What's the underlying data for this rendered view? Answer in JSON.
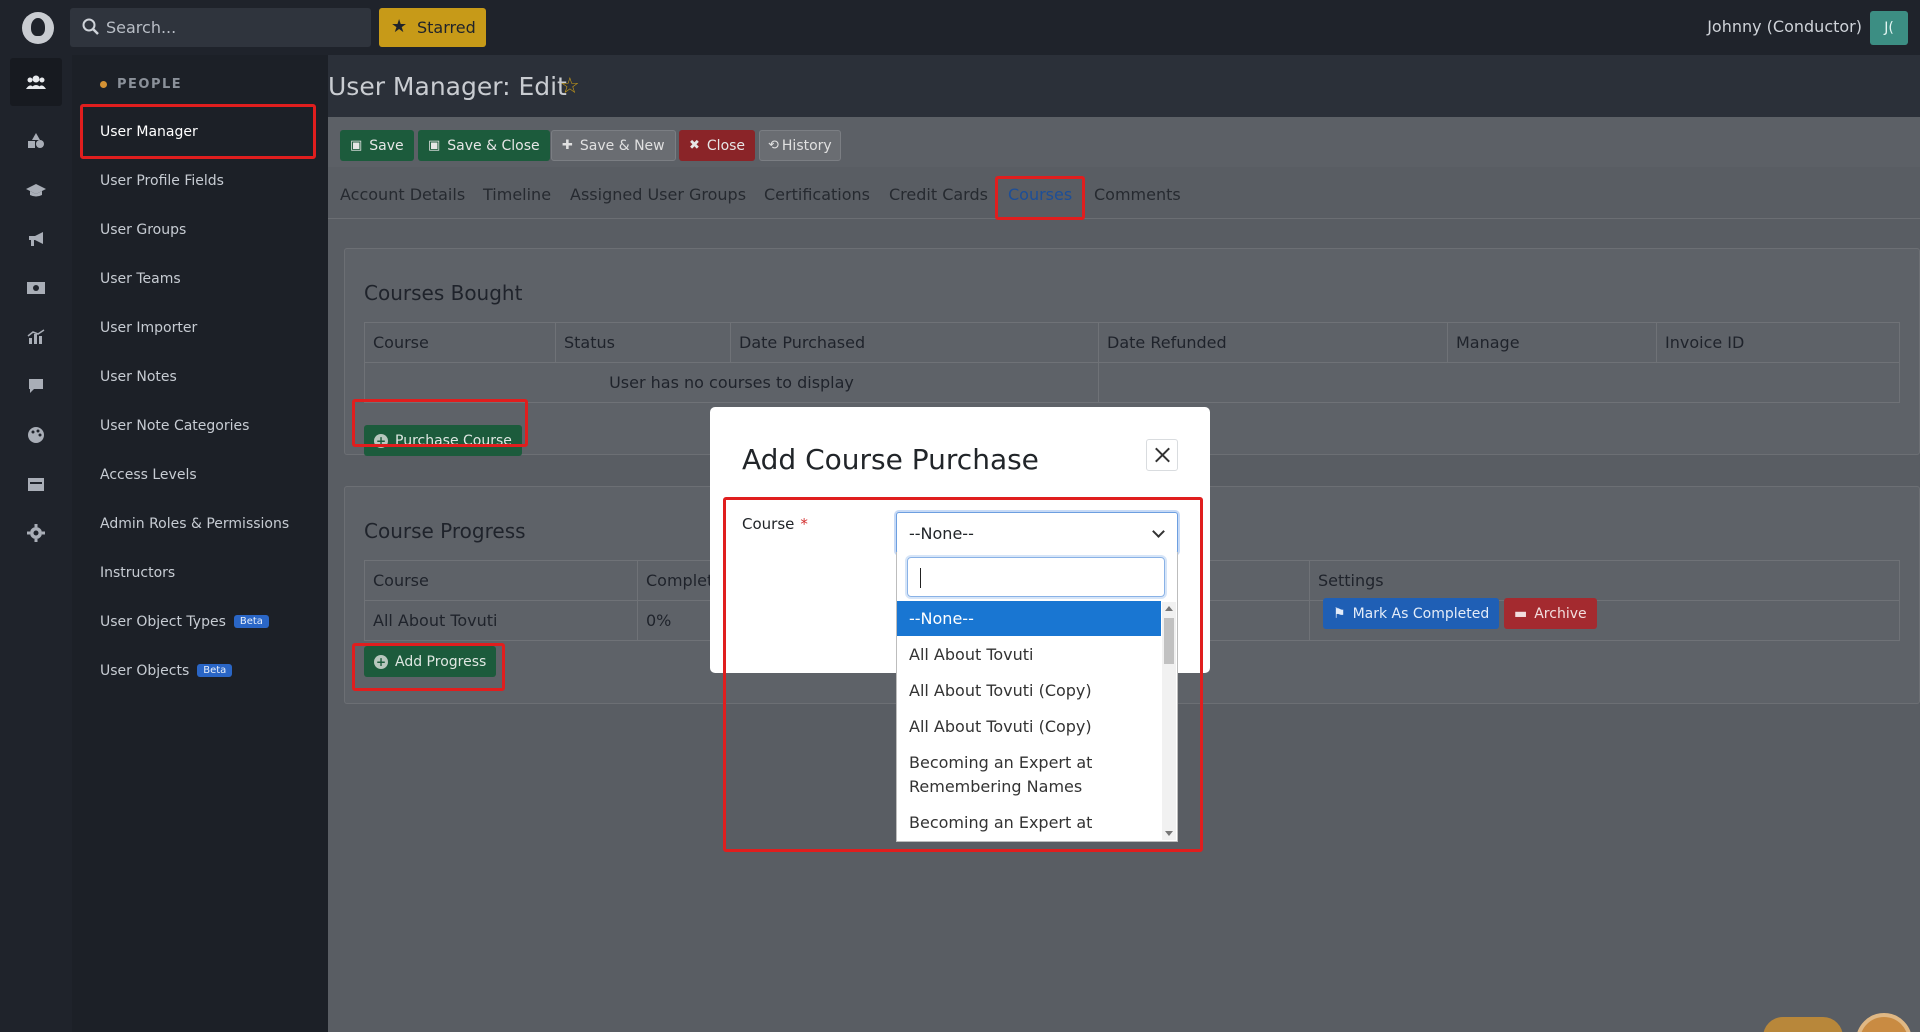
{
  "topbar": {
    "search_placeholder": "Search...",
    "starred_label": "Starred",
    "user_label": "Johnny (Conductor)",
    "avatar_initials": "J("
  },
  "rail": {
    "icons": [
      "users-icon",
      "shapes-icon",
      "graduation-cap-icon",
      "megaphone-icon",
      "money-icon",
      "chart-icon",
      "chat-icon",
      "palette-icon",
      "calendar-icon",
      "gear-icon"
    ]
  },
  "sidebar": {
    "section": "PEOPLE",
    "items": [
      {
        "label": "User Manager"
      },
      {
        "label": "User Profile Fields"
      },
      {
        "label": "User Groups"
      },
      {
        "label": "User Teams"
      },
      {
        "label": "User Importer"
      },
      {
        "label": "User Notes"
      },
      {
        "label": "User Note Categories"
      },
      {
        "label": "Access Levels"
      },
      {
        "label": "Admin Roles & Permissions"
      },
      {
        "label": "Instructors"
      },
      {
        "label": "User Object Types",
        "badge": "Beta"
      },
      {
        "label": "User Objects",
        "badge": "Beta"
      }
    ]
  },
  "page": {
    "title": "User Manager: Edit"
  },
  "toolbar": {
    "save": "Save",
    "save_close": "Save & Close",
    "save_new": "Save & New",
    "close": "Close",
    "history": "History"
  },
  "tabs": [
    "Account Details",
    "Timeline",
    "Assigned User Groups",
    "Certifications",
    "Credit Cards",
    "Courses",
    "Comments"
  ],
  "courses_bought": {
    "heading": "Courses Bought",
    "columns": [
      "Course",
      "Status",
      "Date Purchased",
      "Date Refunded",
      "Manage",
      "Invoice ID"
    ],
    "empty_message": "User has no courses to display",
    "purchase_button": "Purchase Course"
  },
  "course_progress": {
    "heading": "Course Progress",
    "columns": [
      "Course",
      "Complet",
      "Settings"
    ],
    "rows": [
      {
        "course": "All About Tovuti",
        "completion": "0%"
      }
    ],
    "mark_completed": "Mark As Completed",
    "archive": "Archive",
    "add_progress_button": "Add Progress"
  },
  "modal": {
    "title": "Add Course Purchase",
    "field_label": "Course",
    "required_mark": "*",
    "selected_value": "--None--",
    "options": [
      "--None--",
      "All About Tovuti",
      "All About Tovuti (Copy)",
      "All About Tovuti (Copy)",
      "Becoming an Expert at Remembering Names",
      "Becoming an Expert at"
    ]
  },
  "colors": {
    "highlight": "#e01e1e",
    "primary_green": "#1c5b3c",
    "danger": "#8a2428",
    "accent_gold": "#c79a18",
    "selected_option": "#1976d2"
  }
}
